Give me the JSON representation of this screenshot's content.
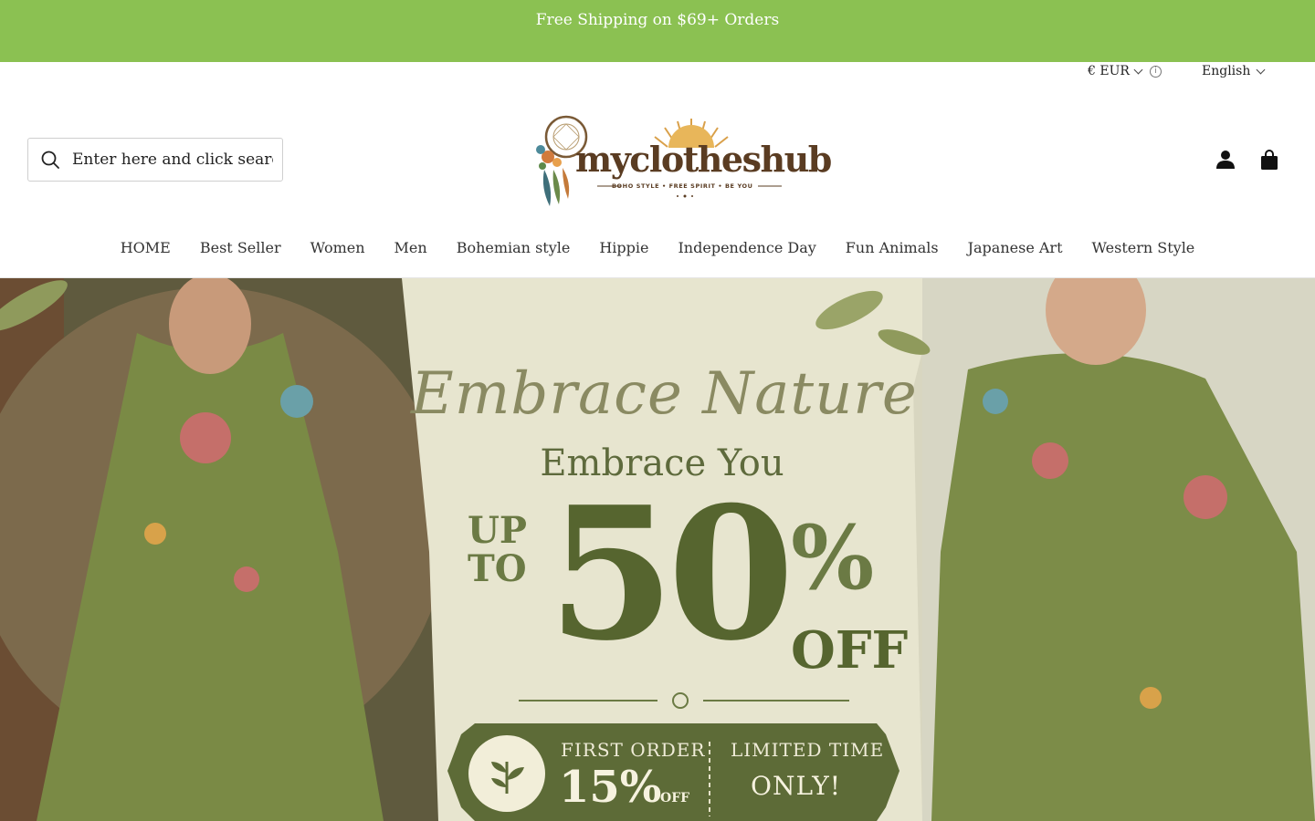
{
  "announcement": {
    "text": "Free Shipping on $69+ Orders",
    "bg_color": "#8bc152"
  },
  "topbar": {
    "currency": "€ EUR",
    "currency_icon": "chevron-down-icon",
    "info_icon": "info-icon",
    "language": "English",
    "language_icon": "chevron-down-icon"
  },
  "header": {
    "search": {
      "placeholder": "Enter here and click search",
      "icon": "search-icon"
    },
    "logo": {
      "text": "myclotheshub",
      "tagline": "BOHO STYLE • FREE SPIRIT • BE YOU"
    },
    "icons": [
      "account-icon",
      "cart-icon"
    ]
  },
  "nav": {
    "items": [
      {
        "label": "HOME"
      },
      {
        "label": "Best Seller"
      },
      {
        "label": "Women"
      },
      {
        "label": "Men"
      },
      {
        "label": "Bohemian style"
      },
      {
        "label": "Hippie"
      },
      {
        "label": "Independence Day"
      },
      {
        "label": "Fun Animals"
      },
      {
        "label": "Japanese Art"
      },
      {
        "label": "Western Style"
      }
    ]
  },
  "hero": {
    "script_title": "Embrace Nature",
    "subtitle": "Embrace You",
    "up_to_line1": "UP",
    "up_to_line2": "TO",
    "discount": "50",
    "percent": "%",
    "off": "OFF",
    "coupon": {
      "first_order": "FIRST ORDER",
      "first_discount": "15%",
      "first_off": "OFF",
      "limited": "LIMITED TIME",
      "only": "ONLY!",
      "icon": "leaf-icon"
    },
    "accent_color": "#56652f"
  }
}
